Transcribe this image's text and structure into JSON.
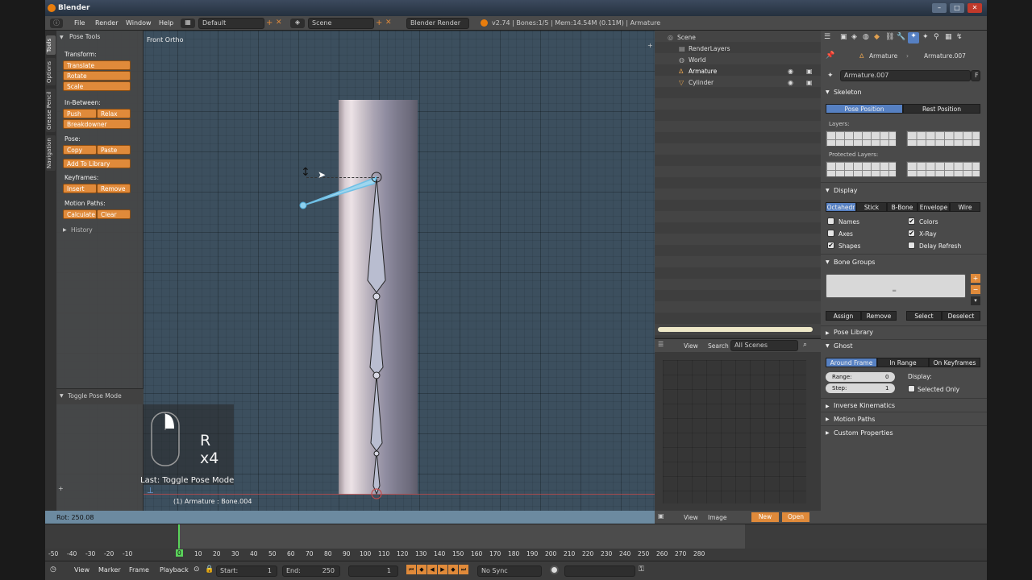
{
  "window": {
    "title": "Blender",
    "controls": [
      "–",
      "□",
      "✕"
    ]
  },
  "menubar": {
    "items": [
      "File",
      "Render",
      "Window",
      "Help"
    ],
    "screen_layout": "Default",
    "scene": "Scene",
    "engine": "Blender Render",
    "info": "v2.74 | Bones:1/5 | Mem:14.54M (0.11M) | Armature"
  },
  "toolshelf": {
    "tabs": [
      "Tools",
      "Options",
      "Grease Pencil",
      "Navigation"
    ],
    "panel_title": "Pose Tools",
    "transform_label": "Transform:",
    "translate": "Translate",
    "rotate": "Rotate",
    "scale": "Scale",
    "inbetween_label": "In-Between:",
    "push": "Push",
    "relax": "Relax",
    "breakdowner": "Breakdowner",
    "pose_label": "Pose:",
    "copy": "Copy",
    "paste": "Paste",
    "add_library": "Add To Library",
    "keyframes_label": "Keyframes:",
    "insert": "Insert",
    "remove": "Remove",
    "motion_paths_label": "Motion Paths:",
    "calculate": "Calculate",
    "clear": "Clear",
    "history": "History",
    "operator_panel": "Toggle Pose Mode"
  },
  "viewport": {
    "view_name": "Front Ortho",
    "key_overlay": "R x4",
    "last_op": "Last: Toggle Pose Mode",
    "object_info": "(1) Armature : Bone.004",
    "header_readout": "Rot: 250.08"
  },
  "outliner": {
    "items": [
      {
        "label": "Scene",
        "depth": 0
      },
      {
        "label": "RenderLayers",
        "depth": 1
      },
      {
        "label": "World",
        "depth": 1
      },
      {
        "label": "Armature",
        "depth": 1
      },
      {
        "label": "Cylinder",
        "depth": 1
      }
    ],
    "view": "View",
    "search": "Search",
    "filter": "All Scenes"
  },
  "image_editor": {
    "view": "View",
    "image": "Image",
    "new": "New",
    "open": "Open"
  },
  "properties": {
    "breadcrumb": [
      "Armature",
      "Armature.007"
    ],
    "datablock": "Armature.007",
    "fake_user": "F",
    "skeleton_title": "Skeleton",
    "pose_position": "Pose Position",
    "rest_position": "Rest Position",
    "layers_label": "Layers:",
    "protected_layers_label": "Protected Layers:",
    "display_title": "Display",
    "display_modes": [
      "Octahedr",
      "Stick",
      "B-Bone",
      "Envelope",
      "Wire"
    ],
    "names": "Names",
    "colors": "Colors",
    "axes": "Axes",
    "xray": "X-Ray",
    "shapes": "Shapes",
    "delay_refresh": "Delay Refresh",
    "bone_groups_title": "Bone Groups",
    "assign": "Assign",
    "remove": "Remove",
    "select": "Select",
    "deselect": "Deselect",
    "pose_library_title": "Pose Library",
    "ghost_title": "Ghost",
    "ghost_modes": [
      "Around Frame",
      "In Range",
      "On Keyframes"
    ],
    "range_label": "Range:",
    "range_value": "0",
    "step_label": "Step:",
    "step_value": "1",
    "display_label": "Display:",
    "selected_only": "Selected Only",
    "ik_title": "Inverse Kinematics",
    "motion_paths_title": "Motion Paths",
    "custom_props_title": "Custom Properties"
  },
  "timeline": {
    "ticks": [
      "-50",
      "-40",
      "-30",
      "-20",
      "-10",
      "0",
      "10",
      "20",
      "30",
      "40",
      "50",
      "60",
      "70",
      "80",
      "90",
      "100",
      "110",
      "120",
      "130",
      "140",
      "150",
      "160",
      "170",
      "180",
      "190",
      "200",
      "210",
      "220",
      "230",
      "240",
      "250",
      "260",
      "270",
      "280"
    ],
    "current_frame": "0",
    "menus": [
      "View",
      "Marker",
      "Frame",
      "Playback"
    ],
    "start_label": "Start:",
    "start": "1",
    "end_label": "End:",
    "end": "250",
    "current": "1",
    "sync": "No Sync"
  }
}
